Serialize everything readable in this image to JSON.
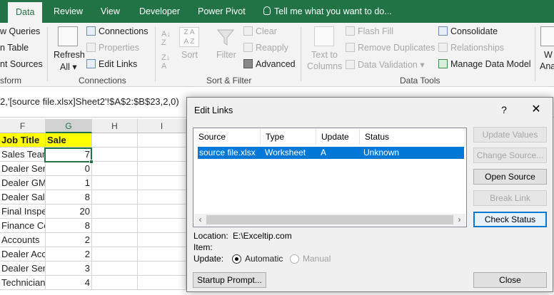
{
  "tabs": [
    {
      "label": "Data",
      "active": true
    },
    {
      "label": "Review"
    },
    {
      "label": "View"
    },
    {
      "label": "Developer"
    },
    {
      "label": "Power Pivot"
    }
  ],
  "tell_me": "Tell me what you want to do...",
  "ribbon": {
    "get_transform": {
      "items": [
        "w Queries",
        "n Table",
        "nt Sources"
      ],
      "label": "sform"
    },
    "connections": {
      "refresh_label": "Refresh",
      "refresh_all": "All",
      "items": [
        "Connections",
        "Properties",
        "Edit Links"
      ],
      "label": "Connections"
    },
    "sort_filter": {
      "sort": "Sort",
      "filter": "Filter",
      "items": [
        "Clear",
        "Reapply",
        "Advanced"
      ],
      "label": "Sort & Filter"
    },
    "data_tools": {
      "text_to_columns_1": "Text to",
      "text_to_columns_2": "Columns",
      "items": [
        "Flash Fill",
        "Remove Duplicates",
        "Data Validation"
      ],
      "items2": [
        "Consolidate",
        "Relationships",
        "Manage Data Model"
      ],
      "label": "Data Tools"
    },
    "forecast": {
      "w1": "W",
      "w2": "Ana"
    }
  },
  "formula": "2,'[source file.xlsx]Sheet2'!$A$2:$B$23,2,0)",
  "grid": {
    "columns": [
      "F",
      "G",
      "H",
      "I"
    ],
    "header_row": [
      "Job Title",
      "Sale"
    ],
    "rows": [
      [
        "Sales Team Lead",
        "7"
      ],
      [
        "Dealer Service",
        "0"
      ],
      [
        "Dealer GM",
        "1"
      ],
      [
        "Dealer Sales",
        "8"
      ],
      [
        "Final Inspector",
        "20"
      ],
      [
        "Finance Co",
        "8"
      ],
      [
        "Accounts",
        "2"
      ],
      [
        "Dealer Accountant",
        "2"
      ],
      [
        "Dealer Service",
        "3"
      ],
      [
        "Technician",
        "4"
      ]
    ]
  },
  "dialog": {
    "title": "Edit Links",
    "help": "?",
    "close_x": "✕",
    "columns": [
      "Source",
      "Type",
      "Update",
      "Status"
    ],
    "row": {
      "source": "source file.xlsx",
      "type": "Worksheet",
      "update": "A",
      "status": "Unknown"
    },
    "location_label": "Location:",
    "location_value": "E:\\Exceltip.com",
    "item_label": "Item:",
    "update_label": "Update:",
    "automatic": "Automatic",
    "manual": "Manual",
    "buttons": {
      "update_values": "Update Values",
      "change_source": "Change Source...",
      "open_source": "Open Source",
      "break_link": "Break Link",
      "check_status": "Check Status",
      "startup_prompt": "Startup Prompt...",
      "close": "Close"
    }
  },
  "colors": {
    "excel_green": "#217346",
    "selection_blue": "#0078d7",
    "header_yellow": "#ffff00"
  }
}
